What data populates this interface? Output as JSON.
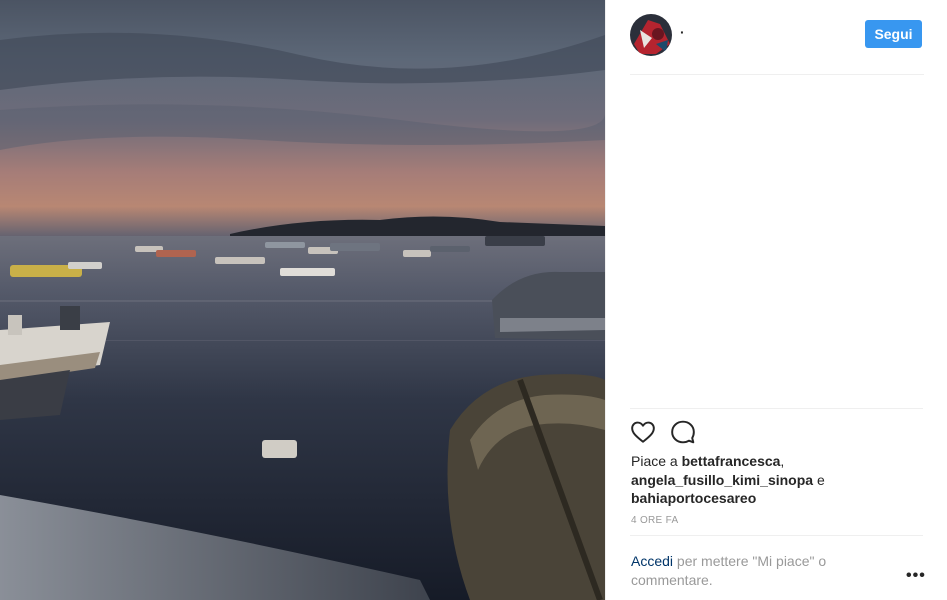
{
  "post": {
    "username": "·",
    "follow_label": "Segui",
    "likes": {
      "prefix": "Piace a",
      "user1": "bettafrancesca",
      "sep1": ",",
      "user2": "angela_fusillo_kimi_sinopa",
      "conj": "e",
      "user3": "bahiaportocesareo"
    },
    "timestamp": "4 ORE FA",
    "login_prompt": {
      "link": "Accedi",
      "text": "per mettere \"Mi piace\" o commentare."
    },
    "more_label": "•••"
  },
  "icons": {
    "like": "heart-icon",
    "comment": "comment-icon",
    "more": "more-options-icon"
  },
  "colors": {
    "follow_button": "#3897f0",
    "link": "#003569",
    "muted": "#999999"
  }
}
